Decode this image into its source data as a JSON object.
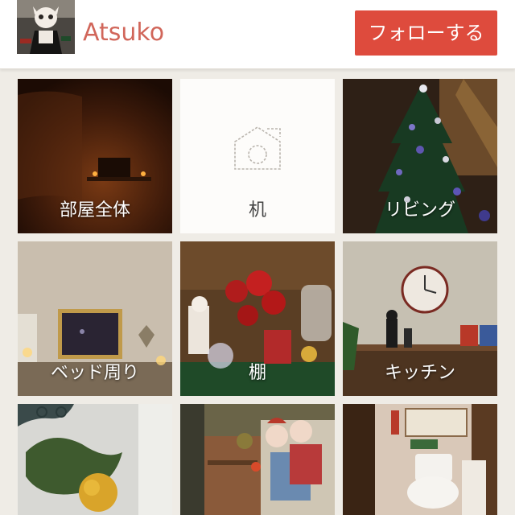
{
  "profile": {
    "username": "Atsuko",
    "follow_label": "フォローする"
  },
  "grid": {
    "tiles": [
      {
        "label": "部屋全体"
      },
      {
        "label": "机"
      },
      {
        "label": "リビング"
      },
      {
        "label": "ベッド周り"
      },
      {
        "label": "棚"
      },
      {
        "label": "キッチン"
      },
      {
        "label": ""
      },
      {
        "label": ""
      },
      {
        "label": ""
      }
    ]
  },
  "colors": {
    "accent": "#de4b3d",
    "username": "#d1665a",
    "background": "#efece6"
  }
}
